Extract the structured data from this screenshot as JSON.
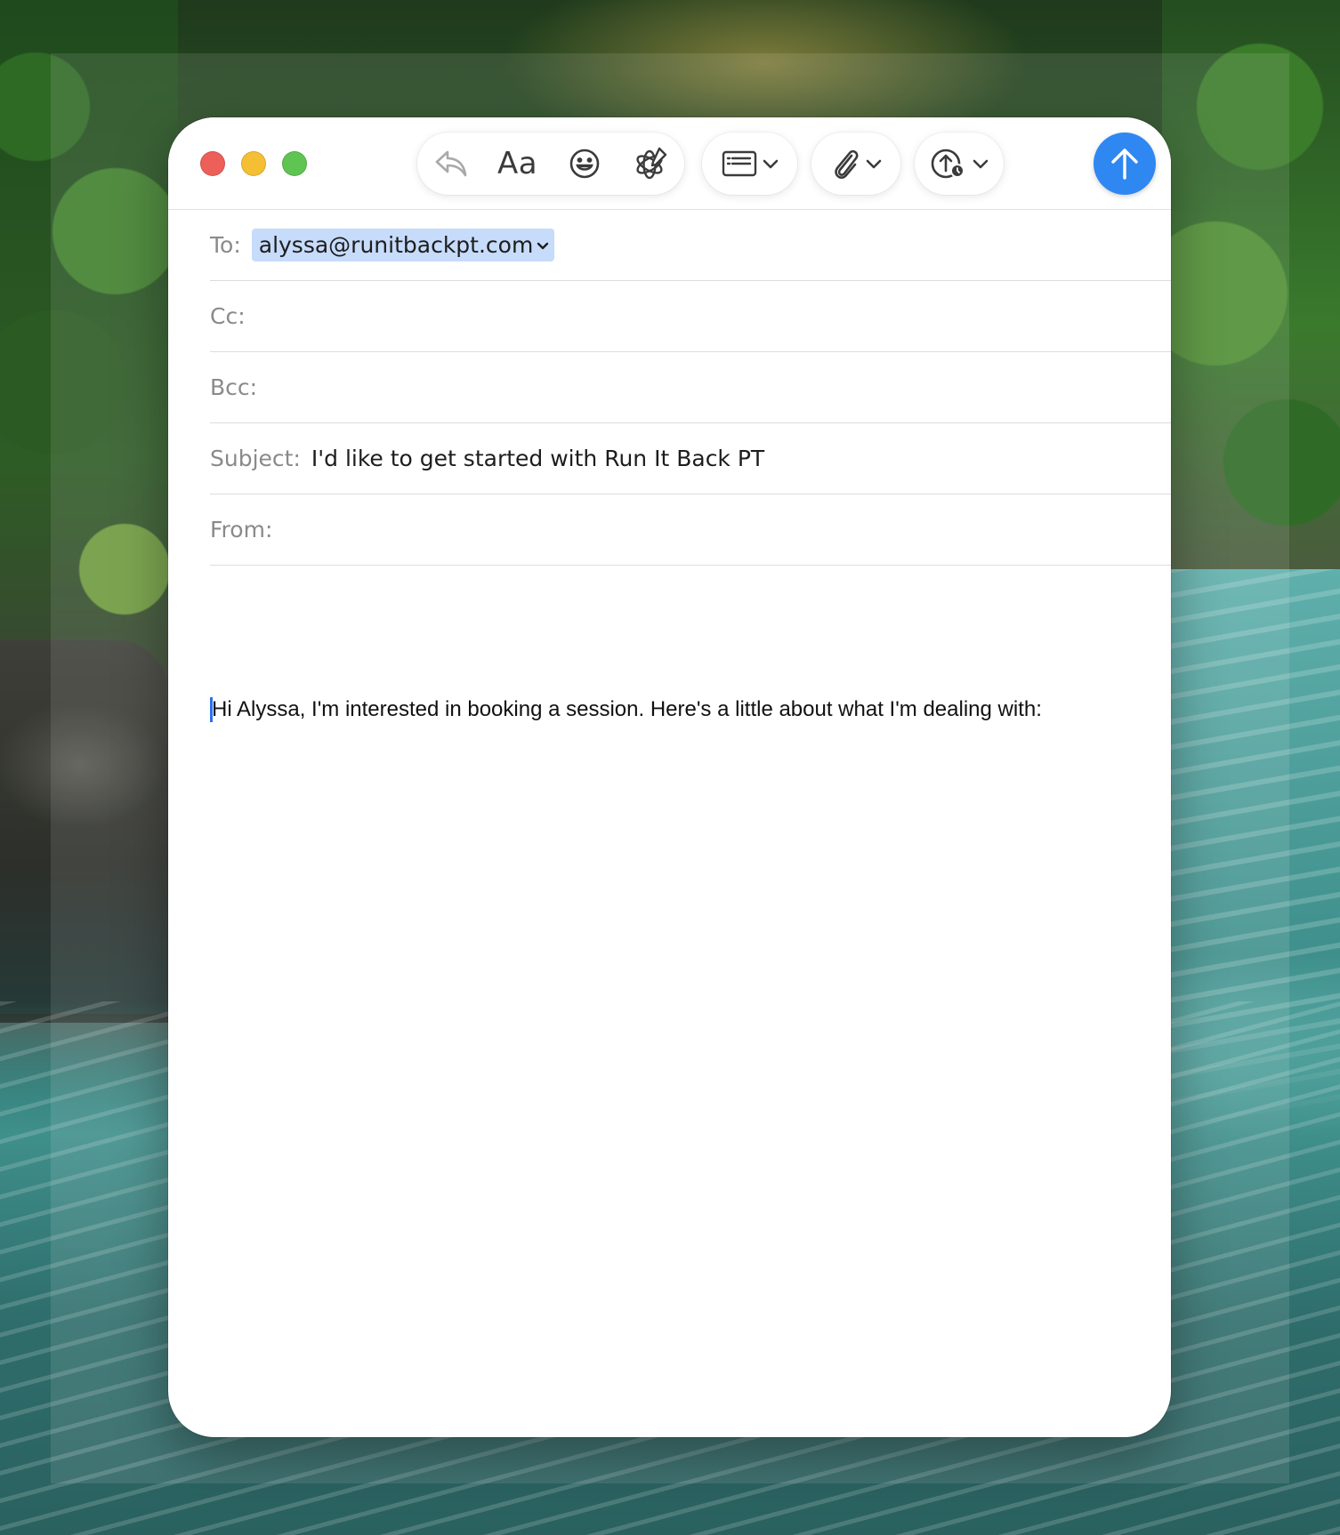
{
  "window": {
    "controls": {
      "close_icon": "close-dot-icon",
      "minimize_icon": "minimize-dot-icon",
      "zoom_icon": "zoom-dot-icon"
    },
    "colors": {
      "close": "#ed5f59",
      "minimize": "#f4bf34",
      "zoom": "#5fc451",
      "send": "#2f87f2",
      "recipient_highlight": "#c7dbfb"
    }
  },
  "toolbar": {
    "reply_icon": "reply-arrow-icon",
    "font_label": "Aa",
    "emoji_icon": "emoji-face-icon",
    "writing_tools_icon": "writing-tools-icon",
    "header_fields_icon": "header-fields-icon",
    "attach_icon": "paperclip-icon",
    "photo_browser_icon": "upload-photo-icon",
    "send_icon": "send-arrow-up-icon"
  },
  "headers": {
    "to_label": "To:",
    "to_value": "alyssa@runitbackpt.com",
    "cc_label": "Cc:",
    "bcc_label": "Bcc:",
    "subject_label": "Subject:",
    "subject_value": "I'd like to get started with Run It Back PT",
    "from_label": "From:"
  },
  "message": {
    "body": "Hi Alyssa, I'm interested in booking a session. Here's a little about what I'm dealing with:"
  }
}
